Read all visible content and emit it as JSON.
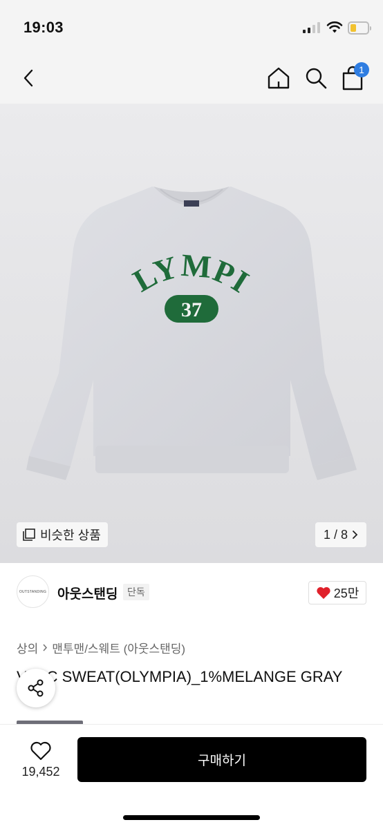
{
  "status": {
    "time": "19:03",
    "battery_level": 0.35
  },
  "nav": {
    "cart_badge": "1"
  },
  "gallery": {
    "print_line1": "OLYMPIA",
    "print_number": "37",
    "similar_label": "비슷한 상품",
    "pager": "1 / 8"
  },
  "brand": {
    "logo_text": "OUTSTANDING",
    "name": "아웃스탠딩",
    "tag": "단독",
    "likes": "25만"
  },
  "breadcrumb": [
    "상의",
    "맨투맨/스웨트 (아웃스탠딩)"
  ],
  "product": {
    "title": "VARC SWEAT(OLYMPIA)_1%MELANGE GRAY"
  },
  "bottom": {
    "wish_count": "19,452",
    "buy_label": "구매하기"
  },
  "colors": {
    "accent_blue": "#2f7de1",
    "heart_red": "#e0212b",
    "print_green": "#1f6b3a",
    "sweat_gray": "#d9dadf"
  }
}
